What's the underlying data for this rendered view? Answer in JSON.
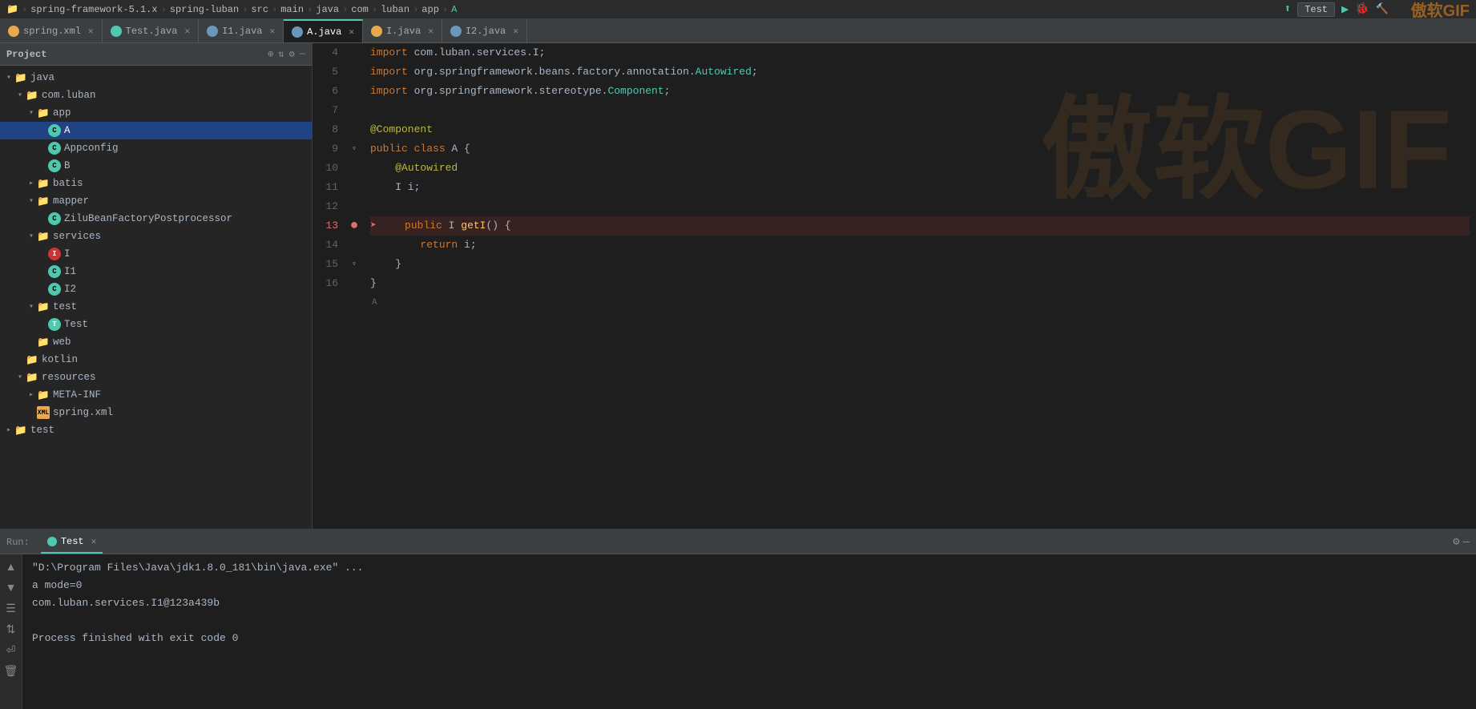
{
  "breadcrumb": {
    "items": [
      {
        "label": "spring-framework-5.1.x",
        "icon": "folder"
      },
      {
        "label": "spring-luban",
        "icon": "folder"
      },
      {
        "label": "src",
        "icon": "folder"
      },
      {
        "label": "main",
        "icon": "folder"
      },
      {
        "label": "java",
        "icon": "folder"
      },
      {
        "label": "com",
        "icon": "folder"
      },
      {
        "label": "luban",
        "icon": "folder"
      },
      {
        "label": "app",
        "icon": "folder"
      },
      {
        "label": "A",
        "icon": "class",
        "active": true
      }
    ]
  },
  "tabs": [
    {
      "label": "spring.xml",
      "icon": "xml",
      "closable": true
    },
    {
      "label": "Test.java",
      "icon": "java-green",
      "closable": true
    },
    {
      "label": "I1.java",
      "icon": "java-blue",
      "closable": true
    },
    {
      "label": "A.java",
      "icon": "java-blue",
      "active": true,
      "closable": true
    },
    {
      "label": "I.java",
      "icon": "java-orange",
      "closable": true
    },
    {
      "label": "I2.java",
      "icon": "java-blue",
      "closable": true
    }
  ],
  "sidebar": {
    "title": "Project",
    "tree": [
      {
        "indent": 0,
        "arrow": "▾",
        "type": "folder",
        "label": "java",
        "depth": 1
      },
      {
        "indent": 1,
        "arrow": "▾",
        "type": "folder",
        "label": "com.luban",
        "depth": 2
      },
      {
        "indent": 2,
        "arrow": "▾",
        "type": "folder",
        "label": "app",
        "depth": 3
      },
      {
        "indent": 3,
        "arrow": "",
        "type": "class",
        "label": "A",
        "depth": 4,
        "selected": true
      },
      {
        "indent": 3,
        "arrow": "",
        "type": "class",
        "label": "Appconfig",
        "depth": 4
      },
      {
        "indent": 3,
        "arrow": "",
        "type": "class-b",
        "label": "B",
        "depth": 4
      },
      {
        "indent": 2,
        "arrow": "▸",
        "type": "folder",
        "label": "batis",
        "depth": 3
      },
      {
        "indent": 2,
        "arrow": "▾",
        "type": "folder",
        "label": "mapper",
        "depth": 3
      },
      {
        "indent": 3,
        "arrow": "",
        "type": "class",
        "label": "ZiluBeanFactoryPostprocessor",
        "depth": 4
      },
      {
        "indent": 2,
        "arrow": "▾",
        "type": "folder",
        "label": "services",
        "depth": 3
      },
      {
        "indent": 3,
        "arrow": "",
        "type": "interface",
        "label": "I",
        "depth": 4
      },
      {
        "indent": 3,
        "arrow": "",
        "type": "class",
        "label": "I1",
        "depth": 4
      },
      {
        "indent": 3,
        "arrow": "",
        "type": "class",
        "label": "I2",
        "depth": 4
      },
      {
        "indent": 2,
        "arrow": "▾",
        "type": "folder",
        "label": "test",
        "depth": 3
      },
      {
        "indent": 3,
        "arrow": "",
        "type": "test",
        "label": "Test",
        "depth": 4
      },
      {
        "indent": 2,
        "arrow": "",
        "type": "folder-plain",
        "label": "web",
        "depth": 3
      },
      {
        "indent": 1,
        "arrow": "",
        "type": "folder-plain",
        "label": "kotlin",
        "depth": 2
      },
      {
        "indent": 1,
        "arrow": "▾",
        "type": "folder",
        "label": "resources",
        "depth": 2
      },
      {
        "indent": 2,
        "arrow": "▸",
        "type": "folder",
        "label": "META-INF",
        "depth": 3
      },
      {
        "indent": 2,
        "arrow": "",
        "type": "xml",
        "label": "spring.xml",
        "depth": 3
      },
      {
        "indent": 0,
        "arrow": "▸",
        "type": "folder",
        "label": "test",
        "depth": 1
      }
    ]
  },
  "editor": {
    "filename": "A",
    "lines": [
      {
        "num": 4,
        "gutter": "",
        "tokens": [
          {
            "t": "import ",
            "c": "kw2"
          },
          {
            "t": "com.luban.services.I",
            "c": "plain"
          },
          {
            "t": ";",
            "c": "plain"
          }
        ]
      },
      {
        "num": 5,
        "gutter": "",
        "tokens": [
          {
            "t": "import ",
            "c": "kw2"
          },
          {
            "t": "org.springframework.beans.factory.annotation.",
            "c": "plain"
          },
          {
            "t": "Autowired",
            "c": "type"
          },
          {
            "t": ";",
            "c": "plain"
          }
        ]
      },
      {
        "num": 6,
        "gutter": "",
        "tokens": [
          {
            "t": "import ",
            "c": "kw2"
          },
          {
            "t": "org.springframework.stereotype.",
            "c": "plain"
          },
          {
            "t": "Component",
            "c": "type"
          },
          {
            "t": ";",
            "c": "plain"
          }
        ]
      },
      {
        "num": 7,
        "gutter": "",
        "tokens": []
      },
      {
        "num": 8,
        "gutter": "",
        "tokens": [
          {
            "t": "@Component",
            "c": "anno"
          }
        ]
      },
      {
        "num": 9,
        "gutter": "",
        "tokens": [
          {
            "t": "public ",
            "c": "kw2"
          },
          {
            "t": "class ",
            "c": "kw2"
          },
          {
            "t": "A ",
            "c": "plain"
          },
          {
            "t": "{",
            "c": "bracket"
          }
        ]
      },
      {
        "num": 10,
        "gutter": "",
        "tokens": [
          {
            "t": "    ",
            "c": "plain"
          },
          {
            "t": "@Autowired",
            "c": "anno"
          }
        ]
      },
      {
        "num": 11,
        "gutter": "",
        "tokens": [
          {
            "t": "    ",
            "c": "plain"
          },
          {
            "t": "I ",
            "c": "plain"
          },
          {
            "t": "i;",
            "c": "plain"
          }
        ]
      },
      {
        "num": 12,
        "gutter": "",
        "tokens": []
      },
      {
        "num": 13,
        "gutter": "breakpoint",
        "tokens": [
          {
            "t": "    ",
            "c": "plain"
          },
          {
            "t": "public ",
            "c": "kw2"
          },
          {
            "t": "I ",
            "c": "plain"
          },
          {
            "t": "getI",
            "c": "method"
          },
          {
            "t": "() {",
            "c": "plain"
          }
        ]
      },
      {
        "num": 14,
        "gutter": "",
        "tokens": [
          {
            "t": "        ",
            "c": "plain"
          },
          {
            "t": "return ",
            "c": "kw2"
          },
          {
            "t": "i;",
            "c": "plain"
          }
        ]
      },
      {
        "num": 15,
        "gutter": "fold",
        "tokens": [
          {
            "t": "    ",
            "c": "plain"
          },
          {
            "t": "}",
            "c": "bracket"
          }
        ]
      },
      {
        "num": 16,
        "gutter": "",
        "tokens": [
          {
            "t": "}",
            "c": "bracket"
          }
        ]
      }
    ]
  },
  "run_panel": {
    "label": "Run:",
    "tab_label": "Test",
    "output_lines": [
      {
        "text": "\"D:\\Program Files\\Java\\jdk1.8.0_181\\bin\\java.exe\" ...",
        "class": "path-line"
      },
      {
        "text": "a mode=0",
        "class": "output-line"
      },
      {
        "text": "com.luban.services.I1@123a439b",
        "class": "result-line"
      },
      {
        "text": "",
        "class": ""
      },
      {
        "text": "Process finished with exit code 0",
        "class": "finish-line"
      }
    ]
  },
  "top_toolbar": {
    "run_config_label": "Test",
    "run_btn": "▶",
    "debug_btn": "🐛",
    "build_btn": "🔨"
  },
  "watermark": "傲软GIF"
}
